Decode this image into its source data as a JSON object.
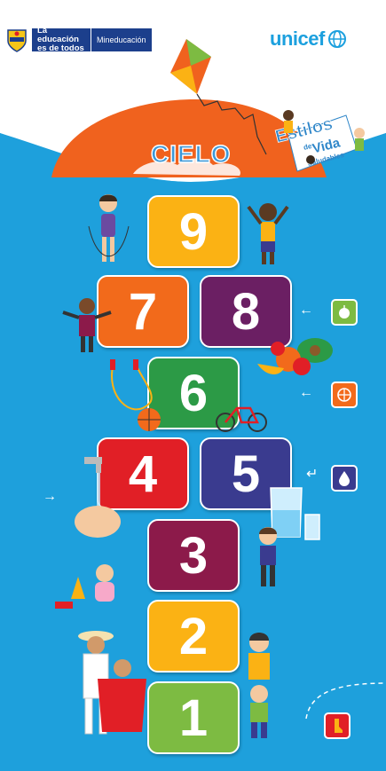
{
  "header": {
    "edu_line1": "La educación",
    "edu_line2": "es de todos",
    "ministry": "Mineducación",
    "partner_logo": "unicef"
  },
  "sky_label": "CIELO",
  "badge": {
    "word1": "Estilos",
    "word2": "de",
    "word3": "Vida",
    "word4": "Saludables"
  },
  "squares": [
    {
      "label": "9",
      "color": "#fbb214"
    },
    {
      "label": "8",
      "color": "#6b1f63"
    },
    {
      "label": "7",
      "color": "#f26a1b"
    },
    {
      "label": "6",
      "color": "#2c9a46"
    },
    {
      "label": "5",
      "color": "#3a3b8f"
    },
    {
      "label": "4",
      "color": "#e11f26"
    },
    {
      "label": "3",
      "color": "#8c1a4a"
    },
    {
      "label": "2",
      "color": "#fbb214"
    },
    {
      "label": "1",
      "color": "#7dbb42"
    }
  ],
  "side_icons": [
    {
      "name": "apple-icon",
      "color": "#7dbb42"
    },
    {
      "name": "basketball-icon",
      "color": "#f26a1b"
    },
    {
      "name": "water-drop-icon",
      "color": "#3a3b8f"
    },
    {
      "name": "shoe-icon",
      "color": "#e11f26"
    }
  ],
  "colors": {
    "background": "#1ea0dc",
    "sun": "#f0621e"
  }
}
